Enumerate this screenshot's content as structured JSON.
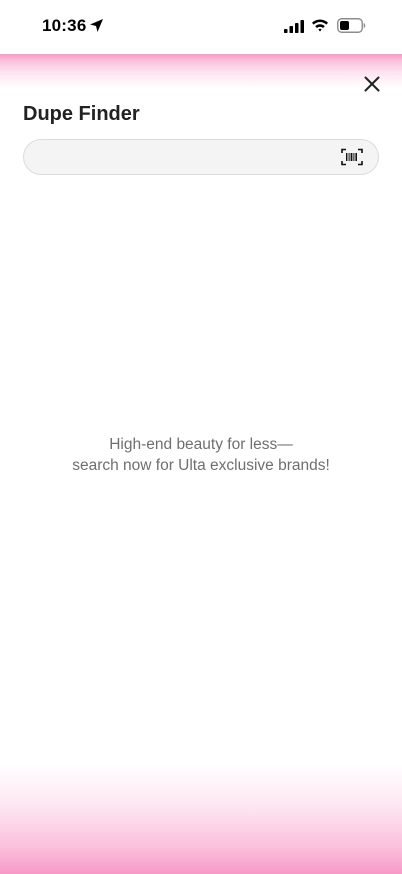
{
  "status_bar": {
    "time": "10:36",
    "icons": [
      "location-arrow-icon",
      "cellular-signal-icon",
      "wifi-icon",
      "battery-icon"
    ]
  },
  "header": {
    "title": "Dupe Finder",
    "close_icon": "close-icon"
  },
  "search": {
    "value": "",
    "placeholder": "",
    "scan_icon": "barcode-scan-icon"
  },
  "empty_state": {
    "line1": "High-end beauty for less—",
    "line2": "search now for Ulta exclusive brands!"
  },
  "colors": {
    "accent_pink": "#f69ac8",
    "text_primary": "#222222",
    "text_secondary": "#6f6f6f",
    "search_bg": "#f4f4f4"
  }
}
